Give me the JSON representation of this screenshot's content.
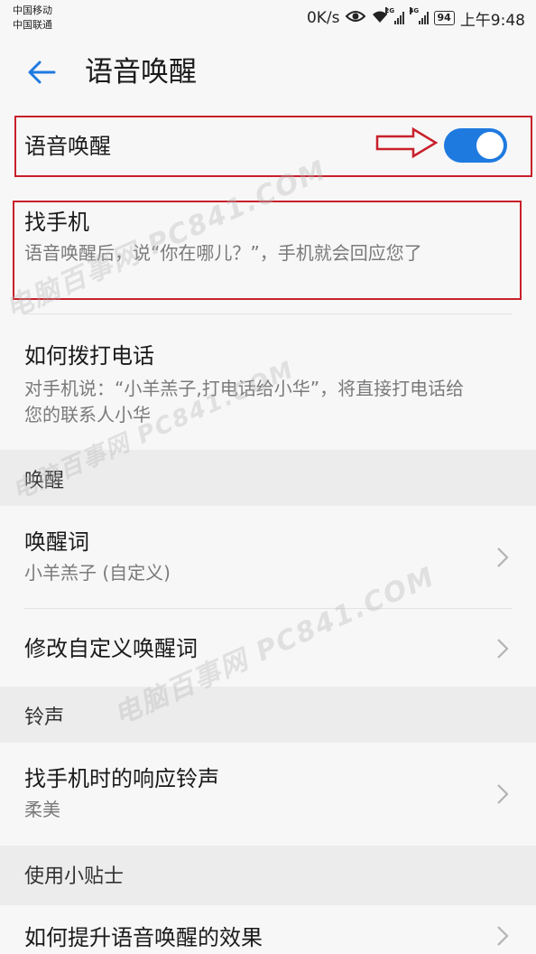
{
  "status_bar": {
    "carrier_1": "中国移动",
    "carrier_2": "中国联通",
    "speed": "0K/s",
    "net_1": "2G",
    "net_2": "4G",
    "battery": "94",
    "time": "上午9:48"
  },
  "toolbar": {
    "back_icon": "arrow-left-icon",
    "title": "语音唤醒"
  },
  "voice_wakeup": {
    "label": "语音唤醒",
    "enabled": true,
    "toggle_color": "#1f7ae0"
  },
  "find_phone": {
    "title": "找手机",
    "desc": "语音唤醒后，说“你在哪儿？”，手机就会回应您了"
  },
  "make_call": {
    "title": "如何拨打电话",
    "desc": "对手机说：“小羊羔子,打电话给小华”，将直接打电话给您的联系人小华"
  },
  "section_wake": {
    "label": "唤醒"
  },
  "wake_word": {
    "title": "唤醒词",
    "value": "小羊羔子 (自定义)"
  },
  "edit_wake_word": {
    "title": "修改自定义唤醒词"
  },
  "section_ringtone": {
    "label": "铃声"
  },
  "ringtone": {
    "title": "找手机时的响应铃声",
    "value": "柔美"
  },
  "section_tips": {
    "label": "使用小贴士"
  },
  "tips_item": {
    "title": "如何提升语音唤醒的效果"
  },
  "watermarks": {
    "w1": "电脑百事网 PC841.COM",
    "w2": "电脑百事网 PC841.COM",
    "w3": "电脑百事网 PC841.COM"
  },
  "annotation_color": "#c8202b"
}
